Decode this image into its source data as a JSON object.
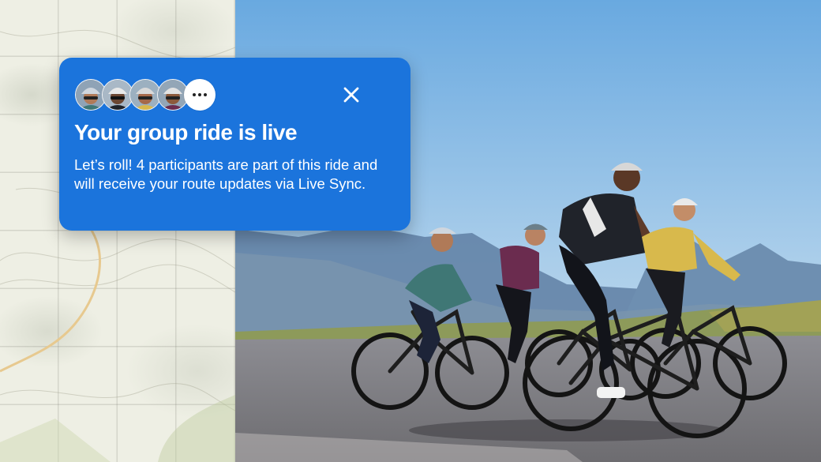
{
  "notification": {
    "title": "Your group ride is live",
    "body": "Let’s roll! 4 participants are part of this ride and will receive your route updates via Live Sync.",
    "participant_count": 4,
    "avatars": [
      {
        "name": "participant-1",
        "helmet": "#cfd6de",
        "face": "#b07a58"
      },
      {
        "name": "participant-2",
        "helmet": "#e8e8e8",
        "face": "#6b4631"
      },
      {
        "name": "participant-3",
        "helmet": "#d9d9d9",
        "face": "#a5694a"
      },
      {
        "name": "participant-4",
        "helmet": "#e2e2e2",
        "face": "#8c5a3c"
      }
    ],
    "more_icon": "ellipsis-icon",
    "close_icon": "close-icon",
    "background_color": "#1b74dc"
  }
}
